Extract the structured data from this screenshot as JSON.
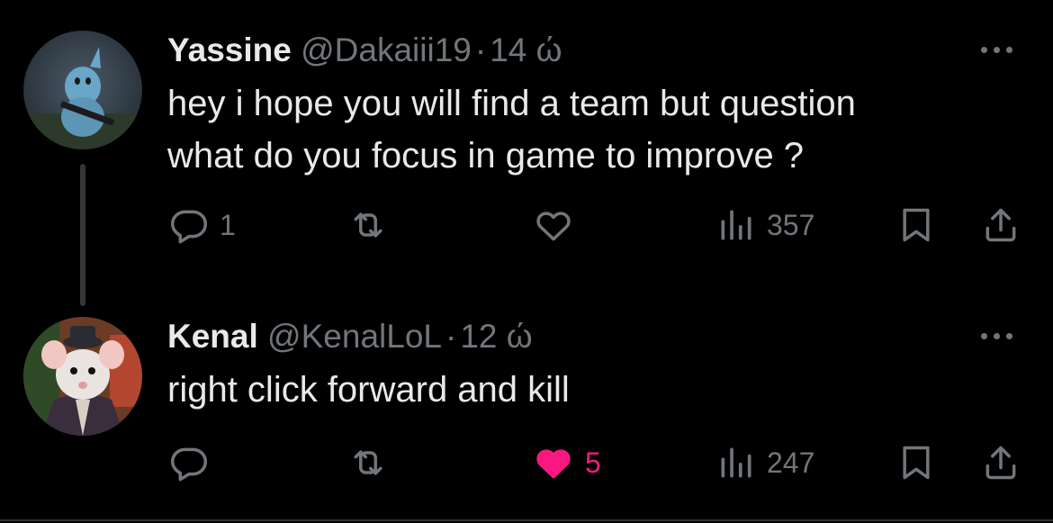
{
  "tweets": [
    {
      "name": "Yassine",
      "handle": "@Dakaiii19",
      "dot": "·",
      "time": "14 ώ",
      "text_lines": [
        "hey i hope you will find a team but question",
        "what do you focus in game to improve ?"
      ],
      "replies": "1",
      "likes": "",
      "liked": false,
      "views": "357"
    },
    {
      "name": "Kenal",
      "handle": "@KenalLoL",
      "dot": "·",
      "time": "12 ώ",
      "text_lines": [
        "right click forward and kill"
      ],
      "replies": "",
      "likes": "5",
      "liked": true,
      "views": "247"
    }
  ],
  "icons": {
    "reply": "reply-icon",
    "retweet": "retweet-icon",
    "like": "heart-icon",
    "views": "views-icon",
    "bookmark": "bookmark-icon",
    "share": "share-icon",
    "more": "more-icon"
  },
  "colors": {
    "background": "#000000",
    "text": "#e7e9ea",
    "muted": "#71767b",
    "like": "#f91880"
  }
}
